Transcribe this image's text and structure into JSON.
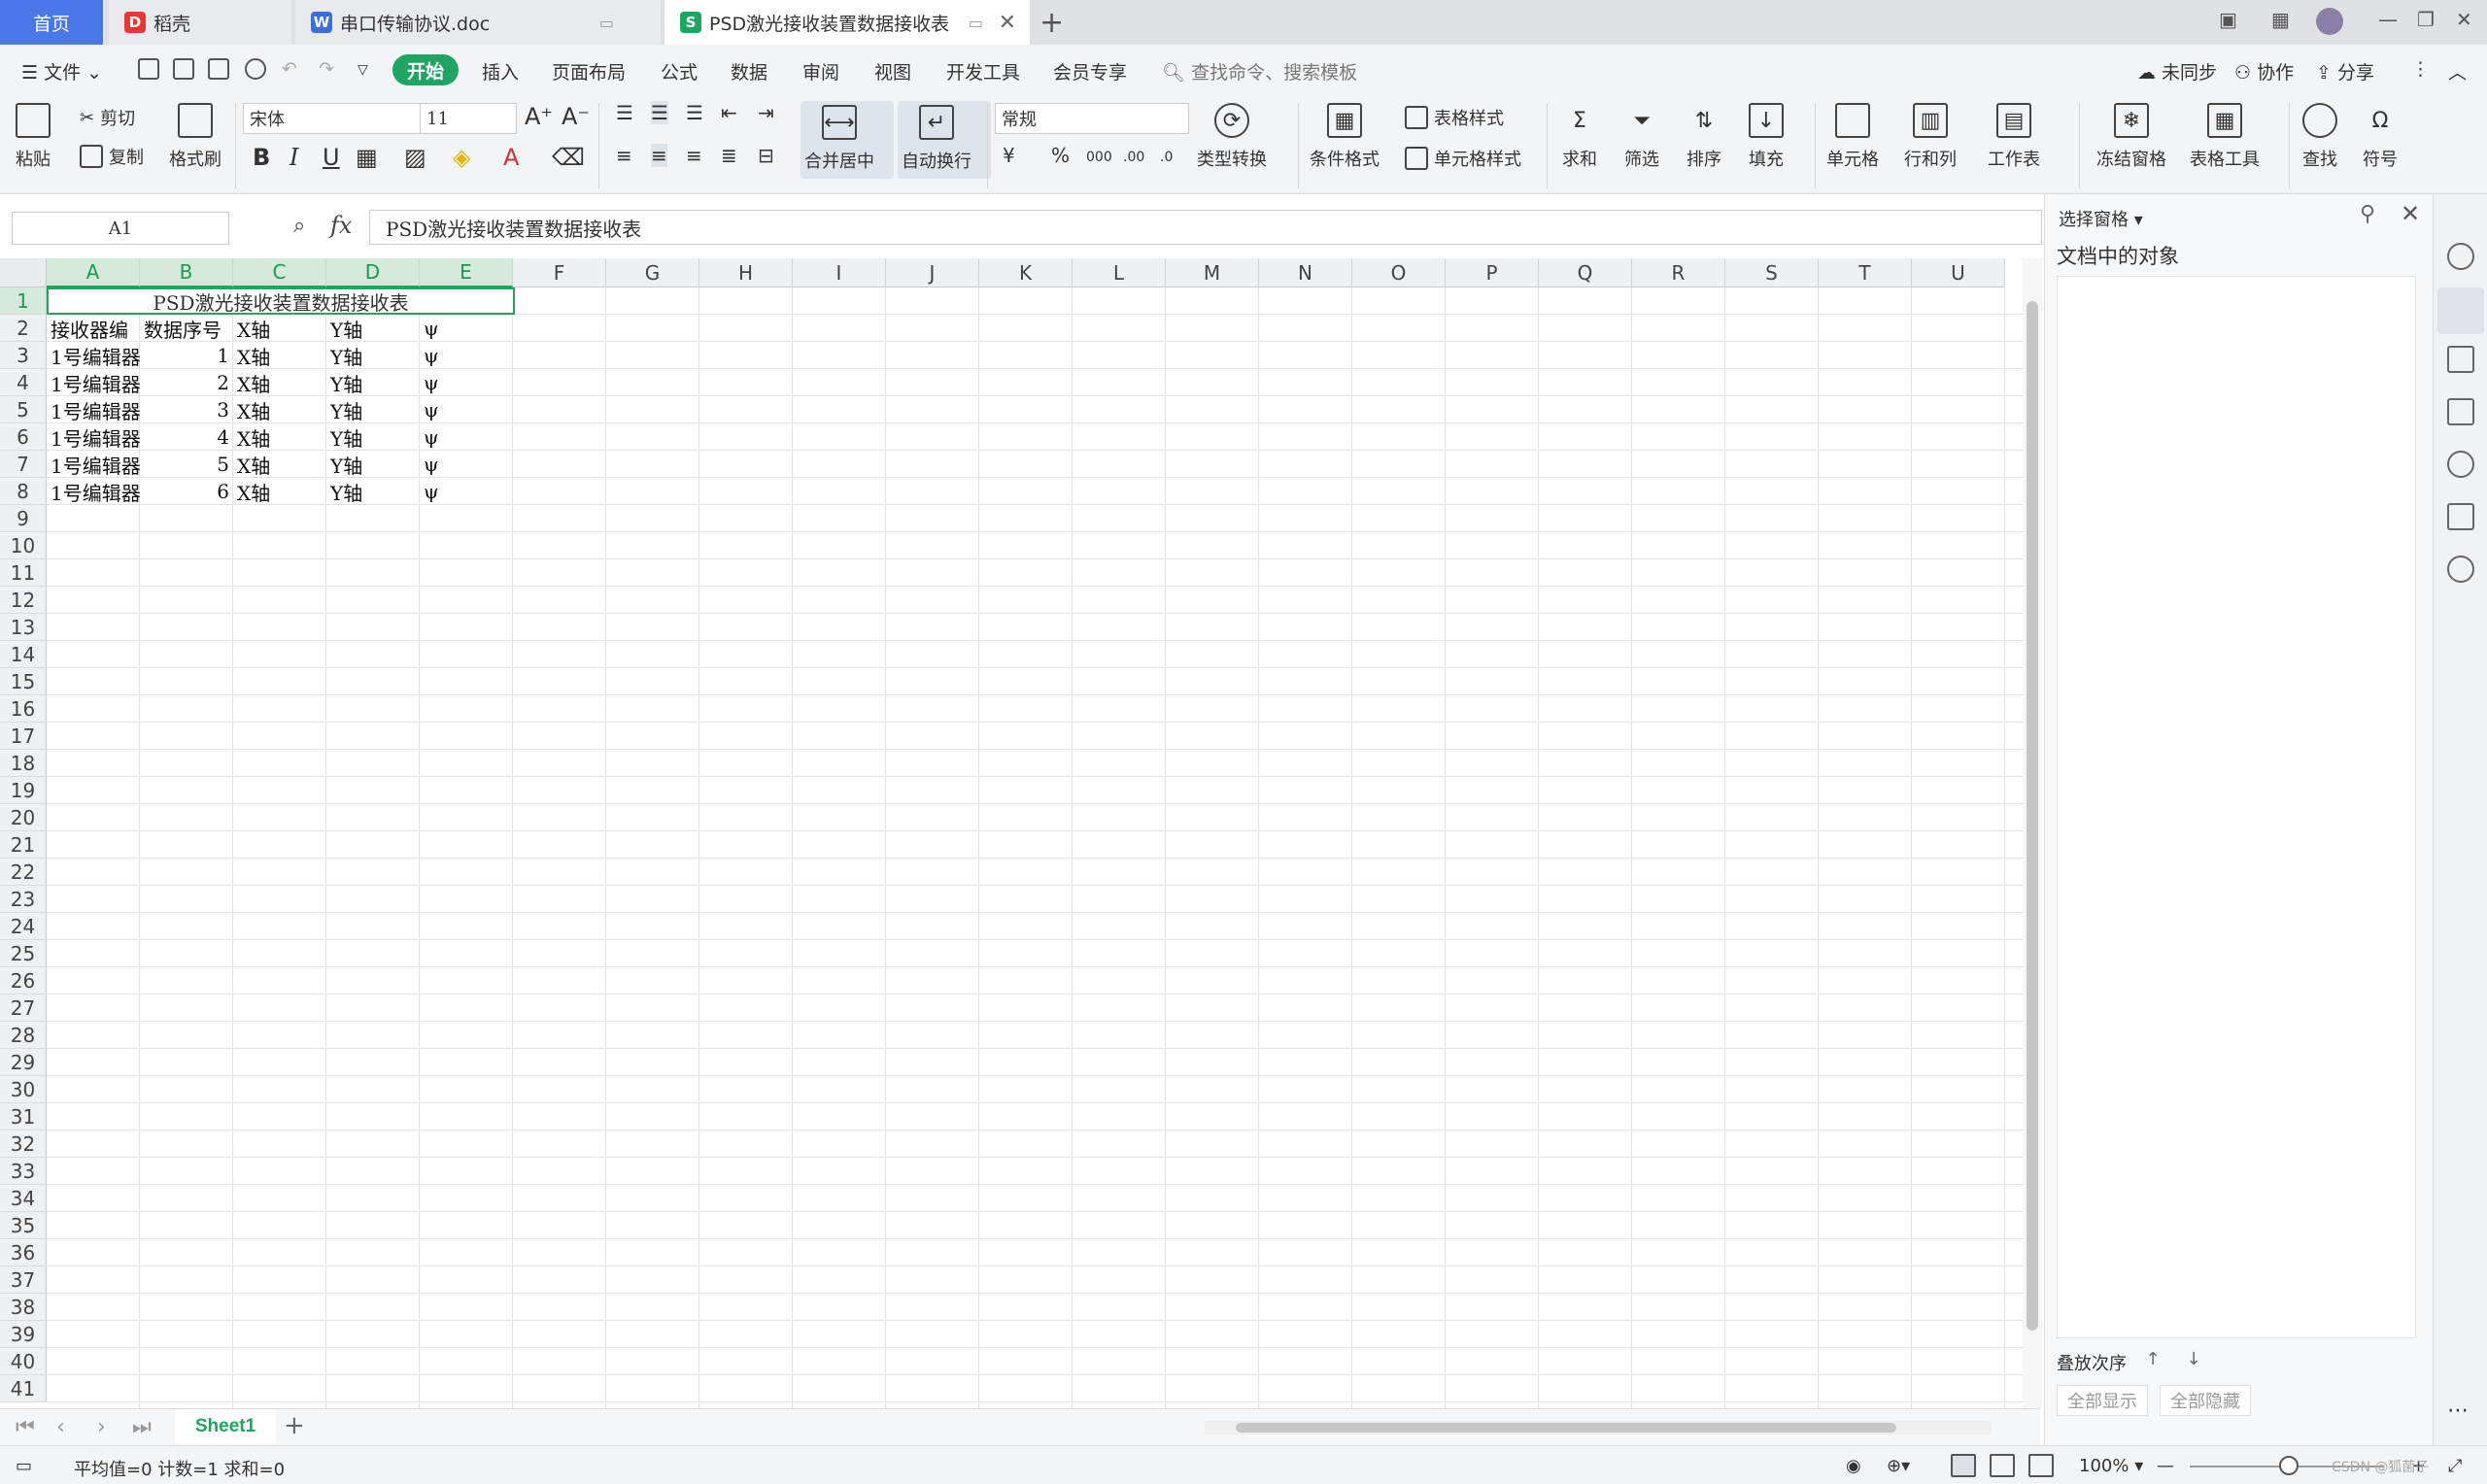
{
  "tabs": {
    "home": "首页",
    "daoke": "稻壳",
    "doc": "串口传输协议.doc",
    "xls": "PSD激光接收装置数据接收表"
  },
  "menu": {
    "file": "文件",
    "start": "开始",
    "items": [
      "插入",
      "页面布局",
      "公式",
      "数据",
      "审阅",
      "视图",
      "开发工具",
      "会员专享"
    ],
    "search_placeholder": "查找命令、搜索模板",
    "sync": "未同步",
    "collab": "协作",
    "share": "分享"
  },
  "ribbon": {
    "paste": "粘贴",
    "cut": "剪切",
    "copy": "复制",
    "format_painter": "格式刷",
    "font_name": "宋体",
    "font_size": "11",
    "merge_center": "合并居中",
    "wrap_text": "自动换行",
    "number_format": "常规",
    "type_convert": "类型转换",
    "cond_format": "条件格式",
    "table_style": "表格样式",
    "cell_style": "单元格样式",
    "sum": "求和",
    "filter": "筛选",
    "sort": "排序",
    "fill": "填充",
    "cell": "单元格",
    "row_col": "行和列",
    "worksheet": "工作表",
    "freeze": "冻结窗格",
    "table_tools": "表格工具",
    "find": "查找",
    "symbol": "符号"
  },
  "formula_bar": {
    "name_box": "A1",
    "fx": "fx",
    "content": "PSD激光接收装置数据接收表"
  },
  "columns": [
    "A",
    "B",
    "C",
    "D",
    "E",
    "F",
    "G",
    "H",
    "I",
    "J",
    "K",
    "L",
    "M",
    "N",
    "O",
    "P",
    "Q",
    "R",
    "S",
    "T",
    "U"
  ],
  "sheet": {
    "title": "PSD激光接收装置数据接收表",
    "headers": [
      "接收器编",
      "数据序号",
      "X轴",
      "Y轴",
      "ψ"
    ],
    "rows": [
      [
        "1号编辑器",
        "1",
        "X轴",
        "Y轴",
        "ψ"
      ],
      [
        "1号编辑器",
        "2",
        "X轴",
        "Y轴",
        "ψ"
      ],
      [
        "1号编辑器",
        "3",
        "X轴",
        "Y轴",
        "ψ"
      ],
      [
        "1号编辑器",
        "4",
        "X轴",
        "Y轴",
        "ψ"
      ],
      [
        "1号编辑器",
        "5",
        "X轴",
        "Y轴",
        "ψ"
      ],
      [
        "1号编辑器",
        "6",
        "X轴",
        "Y轴",
        "ψ"
      ]
    ]
  },
  "sheet_tabs": {
    "active": "Sheet1"
  },
  "pane": {
    "title": "选择窗格",
    "heading": "文档中的对象",
    "order": "叠放次序",
    "show_all": "全部显示",
    "hide_all": "全部隐藏"
  },
  "status": {
    "summary": "平均值=0  计数=1  求和=0",
    "zoom": "100%"
  },
  "watermark": "CSDN @狐菌子",
  "colors": {
    "accent": "#1fa461",
    "home_tab": "#4a78e8"
  }
}
